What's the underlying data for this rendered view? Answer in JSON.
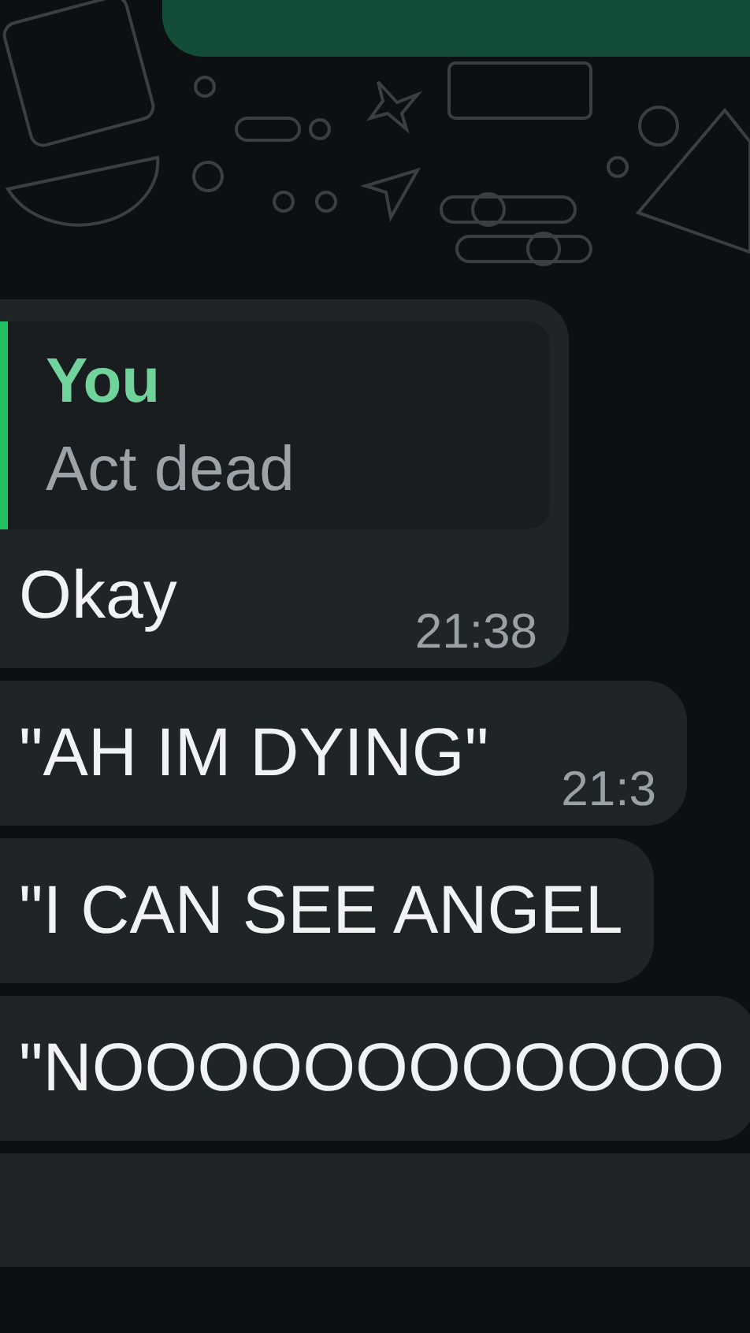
{
  "messages": [
    {
      "kind": "outgoing"
    },
    {
      "kind": "incoming",
      "reply": {
        "author": "You",
        "text": "Act dead"
      },
      "text": "Okay",
      "time": "21:38"
    },
    {
      "kind": "incoming",
      "text": "\"AH IM DYING\"",
      "time": "21:3"
    },
    {
      "kind": "incoming",
      "text": "\"I CAN SEE ANGEL"
    },
    {
      "kind": "incoming",
      "text": "\"NOOOOOOOOOOOO"
    },
    {
      "kind": "incoming"
    }
  ]
}
